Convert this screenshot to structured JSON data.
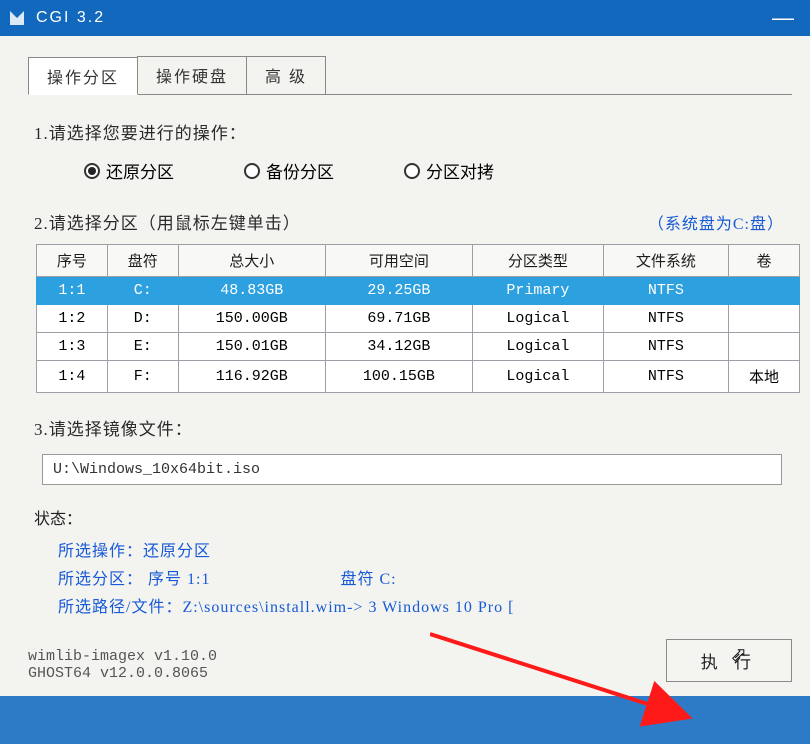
{
  "titlebar": {
    "icon": "app-icon",
    "title": "CGI 3.2"
  },
  "tabs": [
    {
      "label": "操作分区",
      "active": true
    },
    {
      "label": "操作硬盘",
      "active": false
    },
    {
      "label": "高 级",
      "active": false
    }
  ],
  "section1": {
    "label": "1.请选择您要进行的操作：",
    "options": [
      {
        "label": "还原分区",
        "checked": true
      },
      {
        "label": "备份分区",
        "checked": false
      },
      {
        "label": "分区对拷",
        "checked": false
      }
    ]
  },
  "section2": {
    "label": "2.请选择分区（用鼠标左键单击）",
    "sysdisk": "（系统盘为C:盘）",
    "headers": [
      "序号",
      "盘符",
      "总大小",
      "可用空间",
      "分区类型",
      "文件系统",
      "卷"
    ],
    "rows": [
      {
        "cells": [
          "1:1",
          "C:",
          "48.83GB",
          "29.25GB",
          "Primary",
          "NTFS",
          ""
        ],
        "selected": true
      },
      {
        "cells": [
          "1:2",
          "D:",
          "150.00GB",
          "69.71GB",
          "Logical",
          "NTFS",
          ""
        ],
        "selected": false
      },
      {
        "cells": [
          "1:3",
          "E:",
          "150.01GB",
          "34.12GB",
          "Logical",
          "NTFS",
          ""
        ],
        "selected": false
      },
      {
        "cells": [
          "1:4",
          "F:",
          "116.92GB",
          "100.15GB",
          "Logical",
          "NTFS",
          "本地"
        ],
        "selected": false
      }
    ]
  },
  "section3": {
    "label": "3.请选择镜像文件：",
    "path": "U:\\Windows_10x64bit.iso"
  },
  "status": {
    "label": "状态：",
    "line1": "所选操作：还原分区",
    "line2a": "所选分区：  序号 1:1",
    "line2b": "盘符 C:",
    "line3": "所选路径/文件：Z:\\sources\\install.wim-> 3  Windows 10 Pro ["
  },
  "footer": {
    "v1": "wimlib-imagex v1.10.0",
    "v2": "GHOST64 v12.0.0.8065",
    "exec": "执 行"
  }
}
